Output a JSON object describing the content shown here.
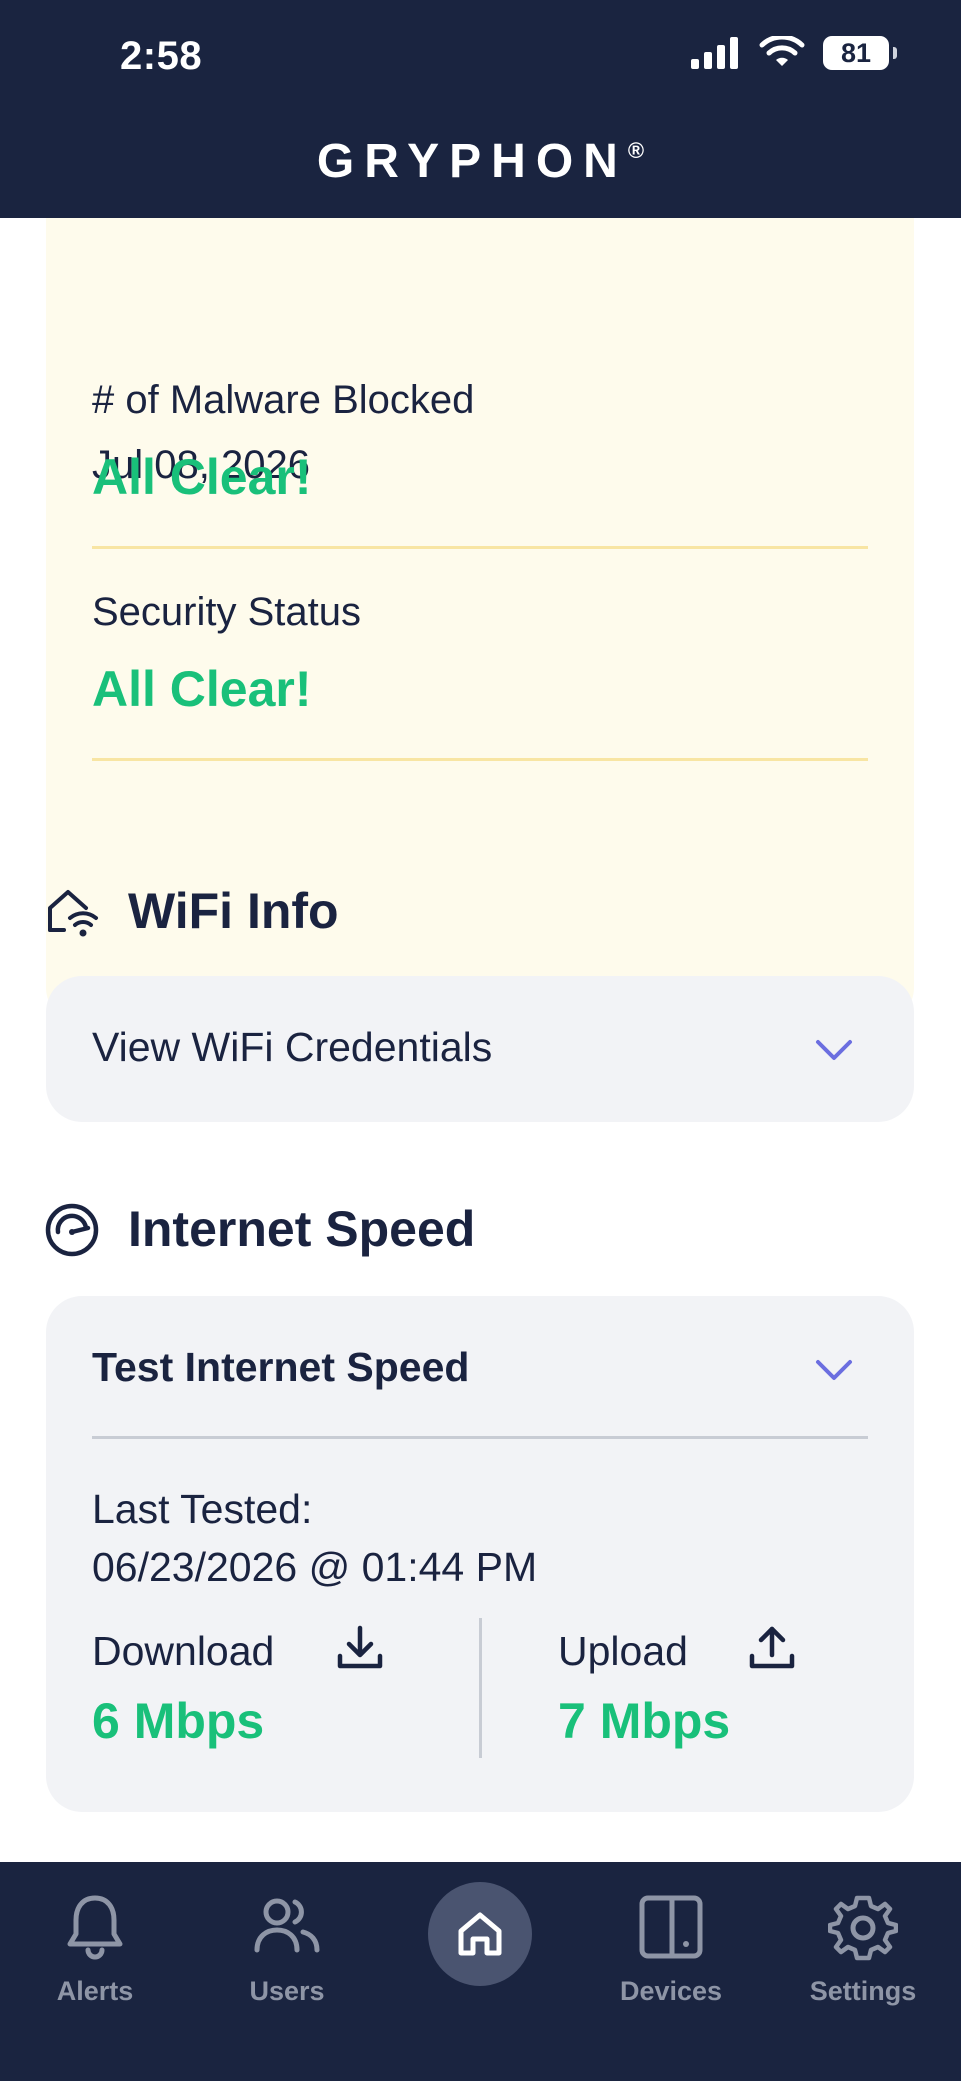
{
  "status_bar": {
    "time": "2:58",
    "battery": "81"
  },
  "header": {
    "logo": "GRYPHON",
    "logo_mark": "®"
  },
  "security_card": {
    "date": "Jul 08, 2026",
    "malware_label": "# of Malware Blocked",
    "malware_value": "All Clear!",
    "security_label": "Security Status",
    "security_value": "All Clear!"
  },
  "wifi_info": {
    "title": "WiFi Info",
    "credentials_label": "View WiFi Credentials"
  },
  "internet_speed": {
    "title": "Internet Speed",
    "test_label": "Test Internet Speed",
    "last_tested_label": "Last Tested:",
    "last_tested_value": "06/23/2026 @ 01:44 PM",
    "download_label": "Download",
    "download_value": "6 Mbps",
    "upload_label": "Upload",
    "upload_value": "7 Mbps"
  },
  "colors": {
    "navy": "#1a2440",
    "green": "#19c07a",
    "chevron": "#6b6ee0",
    "card_yellow": "#fefbec",
    "card_gray": "#f2f3f6"
  },
  "bottom_nav": {
    "items": [
      {
        "label": "Alerts",
        "icon": "bell-icon"
      },
      {
        "label": "Users",
        "icon": "users-icon"
      },
      {
        "label": "",
        "icon": "home-icon"
      },
      {
        "label": "Devices",
        "icon": "devices-icon"
      },
      {
        "label": "Settings",
        "icon": "gear-icon"
      }
    ]
  }
}
